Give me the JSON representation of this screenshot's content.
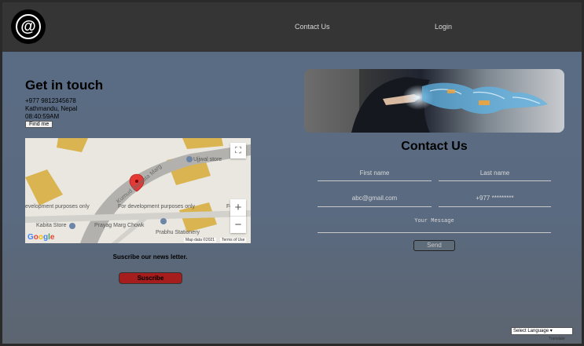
{
  "header": {
    "logo_symbol": "@",
    "nav": {
      "contact": "Contact Us",
      "login": "Login"
    }
  },
  "get_in_touch": {
    "title": "Get in touch",
    "phone": "+977 9812345678",
    "address": "Kathmandu, Nepal",
    "time": "08:40:59AM",
    "find_button": "Find me"
  },
  "map": {
    "labels": {
      "ujjwal": "Ujjwal store",
      "road": "Kumud Bankata Marg",
      "dev_left": "evelopment purposes only",
      "dev_mid": "For development purposes only",
      "dev_right": "For de",
      "kabita": "Kabita Store",
      "prayag": "Prayag Marg Chowk",
      "prabhu": "Prabhu Stationery"
    },
    "google": "Google",
    "map_data": "Map data ©2021",
    "terms": "Terms of Use",
    "zoom_in": "+",
    "zoom_out": "−",
    "colors": {
      "blocks": "#d9b450",
      "road": "#aaa9a5",
      "pin": "#e53935"
    }
  },
  "newsletter": {
    "text": "Suscribe our news letter.",
    "button": "Suscribe"
  },
  "contact": {
    "title": "Contact Us",
    "first_name_placeholder": "First name",
    "last_name_placeholder": "Last name",
    "email_placeholder": "abc@gmail.com",
    "phone_placeholder": "+977 *********",
    "message_placeholder": "Your Message",
    "send_button": "Send"
  },
  "footer": {
    "language": "Select Language",
    "powered": "Translate"
  },
  "colors": {
    "header_bg": "#353535",
    "main_bg": "#5a6c84",
    "subscribe_btn": "#a51d1d"
  }
}
